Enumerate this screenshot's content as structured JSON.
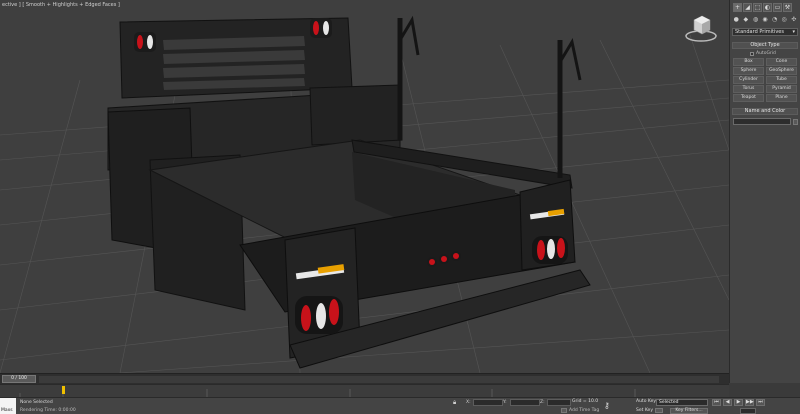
{
  "viewport": {
    "label_left": "ective ] [ Smooth + Highlights + Edged Faces ]",
    "viewcube_label": "",
    "colors": {
      "background": "#3f3f3f",
      "grid": "#5a5a5a",
      "model": "#232323",
      "reflector_red": "#c8121a",
      "reflector_amber": "#e8a000"
    }
  },
  "command_panel": {
    "tabs": [
      "+",
      "◢",
      "⬚",
      "◐",
      "▭",
      "⚒"
    ],
    "subtabs": [
      "●",
      "◆",
      "◍",
      "◉",
      "◔",
      "◎",
      "✣"
    ],
    "category_dropdown": "Standard Primitives",
    "object_type_title": "Object Type",
    "autogrid_label": "AutoGrid",
    "buttons": [
      "Box",
      "Cone",
      "Sphere",
      "GeoSphere",
      "Cylinder",
      "Tube",
      "Torus",
      "Pyramid",
      "Teapot",
      "Plane"
    ],
    "name_color_title": "Name and Color"
  },
  "timeline": {
    "slider_label": "0 / 100"
  },
  "statusbar": {
    "maxscript_label": "Maxs",
    "status": "None Selected",
    "prompt": "Rendering Time: 0:00:00",
    "x_label": "X:",
    "y_label": "Y:",
    "z_label": "Z:",
    "grid": "Grid = 10.0",
    "add_time_tag": "Add Time Tag",
    "auto_key": "Auto Key",
    "selected_option": "Selected",
    "set_key": "Set Key",
    "key_filters": "Key Filters..."
  }
}
